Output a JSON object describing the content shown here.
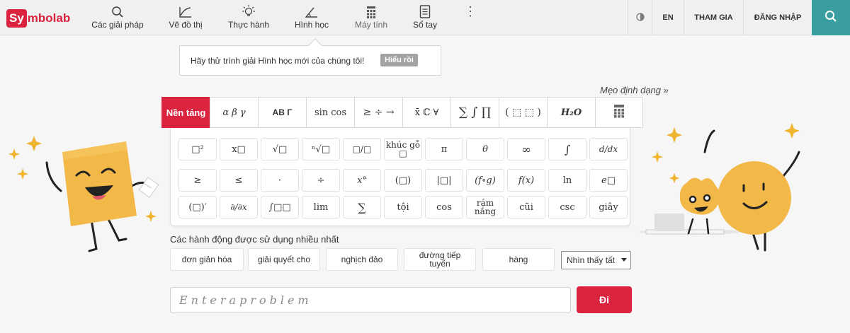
{
  "brand": {
    "logo_box": "Sy",
    "logo_rest": "mbolab",
    "accent": "#d9233f",
    "teal": "#3a9ea0"
  },
  "nav": {
    "items": [
      {
        "label": "Các giải pháp",
        "icon": "search-icon"
      },
      {
        "label": "Vẽ đồ thị",
        "icon": "graph-icon"
      },
      {
        "label": "Thực hành",
        "icon": "lightbulb-icon"
      },
      {
        "label": "Hình học",
        "icon": "angle-icon"
      },
      {
        "label": "Máy tính",
        "icon": "calculator-icon"
      },
      {
        "label": "Sổ tay",
        "icon": "notebook-icon"
      }
    ],
    "more": "⋮",
    "lang": "EN",
    "join": "THAM GIA",
    "login": "ĐĂNG NHẬP"
  },
  "tooltip": {
    "text": "Hãy thử trình giải Hình học mới của chúng tôi!",
    "button": "Hiểu rồi"
  },
  "tips_link": "Mẹo định dạng »",
  "keypad": {
    "tabs": [
      "Nền tảng",
      "α β γ",
      "AB Γ",
      "sin cos",
      "≥ ÷ →",
      "x̄ ℂ ∀",
      "∑ ∫ ∏",
      "( ⬚ ⬚ )",
      "H₂O",
      "calculator-icon"
    ],
    "rows": [
      [
        "□²",
        "x□",
        "√□",
        "ⁿ√□",
        "□/□",
        "khúc gỗ □",
        "π",
        "θ",
        "∞",
        "∫",
        "d/dx"
      ],
      [
        "≥",
        "≤",
        "·",
        "÷",
        "x°",
        "(□)",
        "|□|",
        "(f∘g)",
        "f(x)",
        "ln",
        "e□"
      ],
      [
        "(□)′",
        "∂/∂x",
        "∫□□",
        "lim",
        "∑",
        "tội",
        "cos",
        "rám nắng",
        "cũi",
        "csc",
        "giây"
      ]
    ]
  },
  "frequent": {
    "label": "Các hành động được sử dụng nhiều nhất",
    "actions": [
      "đơn giản hóa",
      "giải quyết cho",
      "nghịch đảo",
      "đường tiếp tuyến",
      "hàng"
    ],
    "see_all": "Nhìn thấy tất"
  },
  "input": {
    "placeholder": "Enteraproblem",
    "go": "Đi"
  }
}
